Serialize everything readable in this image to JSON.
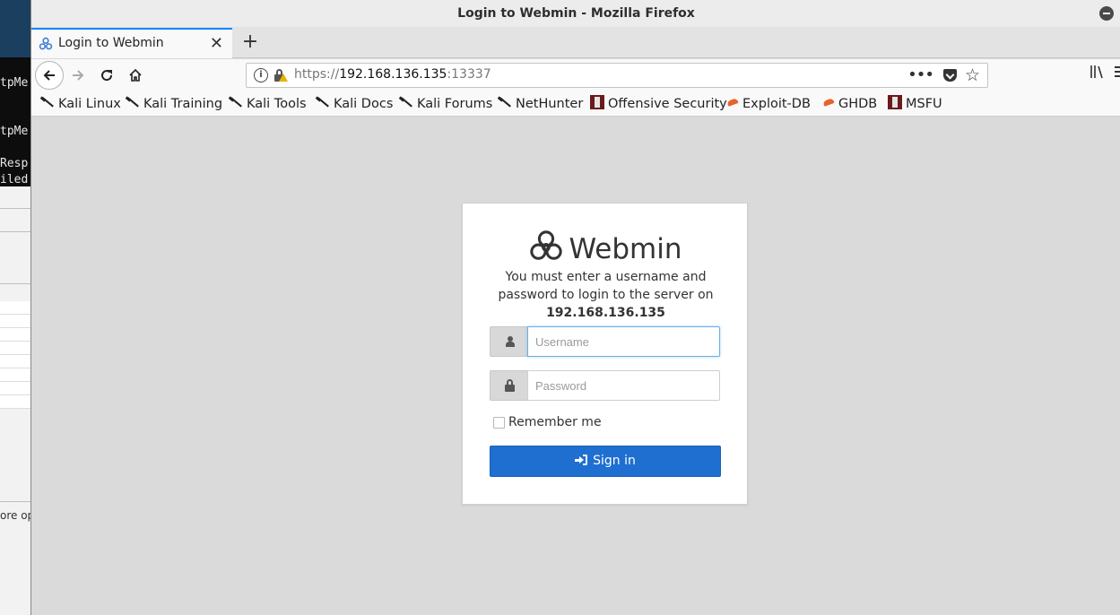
{
  "background_app": {
    "terminal_lines": [
      "tpMe",
      "tpMe",
      "Resp",
      "iled"
    ],
    "footer_text": "ore op"
  },
  "window": {
    "title": "Login to Webmin - Mozilla Firefox"
  },
  "tabs": [
    {
      "title": "Login to Webmin",
      "favicon": "webmin-icon",
      "active": true
    }
  ],
  "navbar": {
    "url_scheme": "https://",
    "url_host": "192.168.136.135",
    "url_port": ":13337",
    "more_label": "•••"
  },
  "bookmarks": [
    {
      "label": "Kali Linux",
      "icon": "kali-dragon-icon"
    },
    {
      "label": "Kali Training",
      "icon": "kali-dragon-icon"
    },
    {
      "label": "Kali Tools",
      "icon": "kali-dragon-icon"
    },
    {
      "label": "Kali Docs",
      "icon": "kali-dragon-icon"
    },
    {
      "label": "Kali Forums",
      "icon": "kali-dragon-icon"
    },
    {
      "label": "NetHunter",
      "icon": "kali-dragon-icon"
    },
    {
      "label": "Offensive Security",
      "icon": "offsec-icon"
    },
    {
      "label": "Exploit-DB",
      "icon": "exploit-db-icon"
    },
    {
      "label": "GHDB",
      "icon": "exploit-db-icon"
    },
    {
      "label": "MSFU",
      "icon": "offsec-icon"
    }
  ],
  "login": {
    "logo_text": "Webmin",
    "message": "You must enter a username and password to login to the server on",
    "host": "192.168.136.135",
    "username_placeholder": "Username",
    "username_value": "",
    "password_placeholder": "Password",
    "password_value": "",
    "remember_label": "Remember me",
    "remember_checked": false,
    "signin_label": "Sign in"
  },
  "colors": {
    "primary_button": "#1e6fd0",
    "active_tab_accent": "#0a84ff",
    "page_background": "#dadada"
  }
}
